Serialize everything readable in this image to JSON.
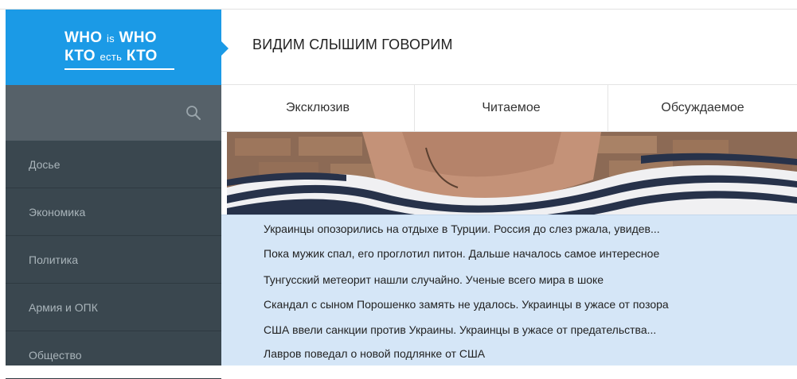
{
  "logo": {
    "line1": [
      "WHO",
      "is",
      "WHO"
    ],
    "line2": [
      "КТО",
      "есть",
      "КТО"
    ]
  },
  "search": {
    "placeholder": "",
    "icon": "search-icon"
  },
  "sidebar": {
    "items": [
      {
        "label": "Досье"
      },
      {
        "label": "Экономика"
      },
      {
        "label": "Политика"
      },
      {
        "label": "Армия и ОПК"
      },
      {
        "label": "Общество"
      }
    ]
  },
  "header": {
    "title": "ВИДИМ СЛЫШИМ ГОВОРИМ"
  },
  "tabs": [
    {
      "label": "Эксклюзив"
    },
    {
      "label": "Читаемое"
    },
    {
      "label": "Обсуждаемое"
    }
  ],
  "headlines": [
    "Украинцы опозорились на отдыхе в Турции. Россия до слез ржала, увидев...",
    "Пока мужик спал, его проглотил питон. Дальше началось самое интересное",
    "Тунгусский метеорит нашли случайно. Ученые всего мира в шоке",
    "Скандал с сыном Порошенко замять не удалось. Украинцы в ужасе от позора",
    "США ввели санкции против Украины. Украинцы в ужасе от предательства...",
    "Лавров поведал о новой подлянке от США"
  ],
  "colors": {
    "brand": "#1b9ae6",
    "sidebar": "#3a474f",
    "search_bar": "#566169",
    "headline_bg": "#d5e6f7"
  }
}
